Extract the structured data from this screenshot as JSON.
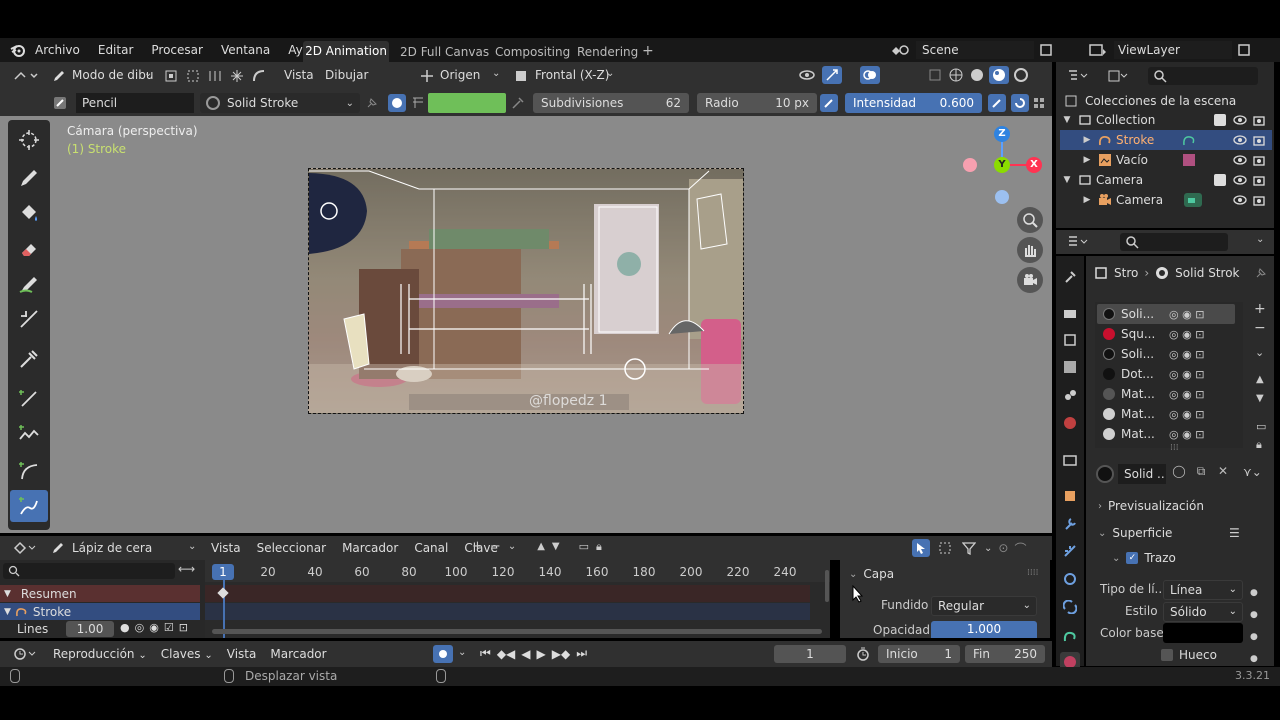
{
  "topbar": {
    "menu": [
      "Archivo",
      "Editar",
      "Procesar",
      "Ventana",
      "Ayuda"
    ],
    "workspaces": [
      "2D Animation",
      "2D Full Canvas",
      "Compositing",
      "Rendering"
    ],
    "add_tab": "+",
    "scene": "Scene",
    "viewlayer": "ViewLayer"
  },
  "header": {
    "mode": "Modo de dibu",
    "menus": [
      "Vista",
      "Dibujar"
    ],
    "origin": "Origen",
    "view": "Frontal (X-Z)"
  },
  "toolsettings": {
    "brush": "Pencil",
    "material": "Solid Stroke",
    "subdiv_label": "Subdivisiones",
    "subdiv_value": "62",
    "radius_label": "Radio",
    "radius_value": "10 px",
    "strength_label": "Intensidad",
    "strength_value": "0.600",
    "color": "#6fbf59"
  },
  "viewport": {
    "camera_label": "Cámara (perspectiva)",
    "object_label": "(1) Stroke",
    "watermark": "@flopedz 1",
    "bg": "#8a8a8a"
  },
  "gizmo": {
    "z": "Z",
    "y": "Y",
    "x": "X"
  },
  "outliner": {
    "title": "Colecciones de la escena",
    "items": [
      {
        "name": "Collection",
        "level": 0
      },
      {
        "name": "Stroke",
        "level": 1
      },
      {
        "name": "Vacío",
        "level": 1
      },
      {
        "name": "Camera",
        "level": 0
      },
      {
        "name": "Camera",
        "level": 1
      }
    ]
  },
  "properties": {
    "breadcrumb_obj": "Stro",
    "breadcrumb_mat": "Solid Strok",
    "materials": [
      "Soli...",
      "Squ...",
      "Soli...",
      "Dot...",
      "Mat...",
      "Mat...",
      "Mat..."
    ],
    "material_colors": [
      "#111111",
      "#c8102e",
      "#111111",
      "#111111",
      "#555555",
      "#cfcfcf",
      "#cfcfcf"
    ],
    "slot_name": "Solid ...",
    "preview": "Previsualización",
    "surface": "Superficie",
    "stroke": "Trazo",
    "line_type_label": "Tipo de lí...",
    "line_type": "Línea",
    "style_label": "Estilo",
    "style": "Sólido",
    "base_color_label": "Color base",
    "base_color": "#000000",
    "holdout": "Hueco"
  },
  "timeline_editor": {
    "mode": "Lápiz de cera",
    "menus": [
      "Vista",
      "Seleccionar",
      "Marcador",
      "Canal",
      "Clave"
    ],
    "current_frame": "1",
    "ticks": [
      "20",
      "40",
      "60",
      "80",
      "100",
      "120",
      "140",
      "160",
      "180",
      "200",
      "220",
      "240"
    ],
    "channels": [
      {
        "name": "Resumen"
      },
      {
        "name": "Stroke"
      }
    ],
    "lines_label": "Lines",
    "lines_value": "1.00",
    "layer_panel": {
      "title": "Capa",
      "blend_label": "Fundido",
      "blend": "Regular",
      "opacity_label": "Opacidad",
      "opacity": "1.000"
    }
  },
  "playback": {
    "menus": [
      "Reproducción",
      "Claves",
      "Vista",
      "Marcador"
    ],
    "frame": "1",
    "start_label": "Inicio",
    "start": "1",
    "end_label": "Fin",
    "end": "250"
  },
  "status": {
    "hint": "Desplazar vista",
    "version": "3.3.21"
  }
}
